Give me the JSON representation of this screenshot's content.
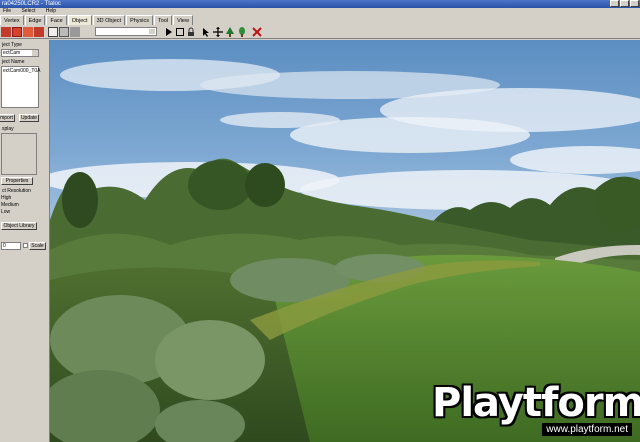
{
  "window": {
    "title": "ra04250LCR2 - Ttaloc"
  },
  "menu": {
    "items": [
      "File",
      "Select",
      "Help"
    ]
  },
  "tabs": [
    {
      "label": "Vertex",
      "active": false
    },
    {
      "label": "Edge",
      "active": false
    },
    {
      "label": "Face",
      "active": false
    },
    {
      "label": "Object",
      "active": true
    },
    {
      "label": "3D Object",
      "active": false
    },
    {
      "label": "Physics",
      "active": false
    },
    {
      "label": "Tool",
      "active": false
    },
    {
      "label": "View",
      "active": false
    }
  ],
  "panel": {
    "object_type_label": "ject Type",
    "object_type_value": "ectCam",
    "object_name_label": "ject Name",
    "object_name_value": "ectCam000_T0A",
    "import_label": "mport",
    "update_label": "Update",
    "display_label": "splay",
    "properties_label": "Properties",
    "resolution_label": "ct Resolution",
    "res_high": "High",
    "res_medium": "Medium",
    "res_low": "Low",
    "object_library_label": "Object Library",
    "scale_label": "Scale",
    "scale_value": "0"
  },
  "watermark": {
    "brand": "Playtform",
    "url": "www.playtform.net"
  },
  "colors": {
    "sky": "#5f93c6",
    "grass": "#4d7a2c",
    "titlebar": "#2a52a8"
  }
}
